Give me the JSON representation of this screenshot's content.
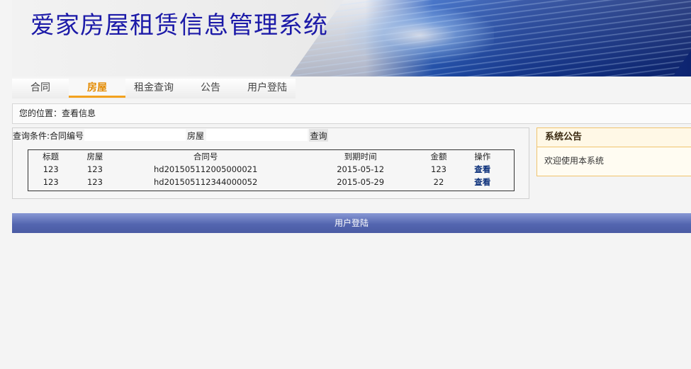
{
  "header": {
    "title": "爱家房屋租赁信息管理系统"
  },
  "nav": {
    "items": [
      {
        "label": "合同"
      },
      {
        "label": "房屋"
      },
      {
        "label": "租金查询"
      },
      {
        "label": "公告"
      },
      {
        "label": "用户登陆"
      }
    ],
    "active": "房屋"
  },
  "breadcrumb": {
    "text": "您的位置：查看信息"
  },
  "query": {
    "condition_label": "查询条件:合同编号",
    "contract_value": "",
    "house_label": "房屋",
    "house_value": "",
    "button_label": "查询"
  },
  "table": {
    "headers": [
      "标题",
      "房屋",
      "合同号",
      "到期时间",
      "金额",
      "操作"
    ],
    "rows": [
      {
        "title": "123",
        "house": "123",
        "contract": "hd201505112005000021",
        "due": "2015-05-12",
        "amount": "123",
        "action": "查看"
      },
      {
        "title": "123",
        "house": "123",
        "contract": "hd201505112344000052",
        "due": "2015-05-29",
        "amount": "22",
        "action": "查看"
      }
    ]
  },
  "notice": {
    "title": "系统公告",
    "body": "欢迎使用本系统"
  },
  "footer": {
    "label": "用户登陆"
  },
  "colors": {
    "title": "#1c1aa8",
    "nav_active": "#e38a00",
    "footer_bar": "#5466b0",
    "notice_border": "#f0c36d"
  }
}
